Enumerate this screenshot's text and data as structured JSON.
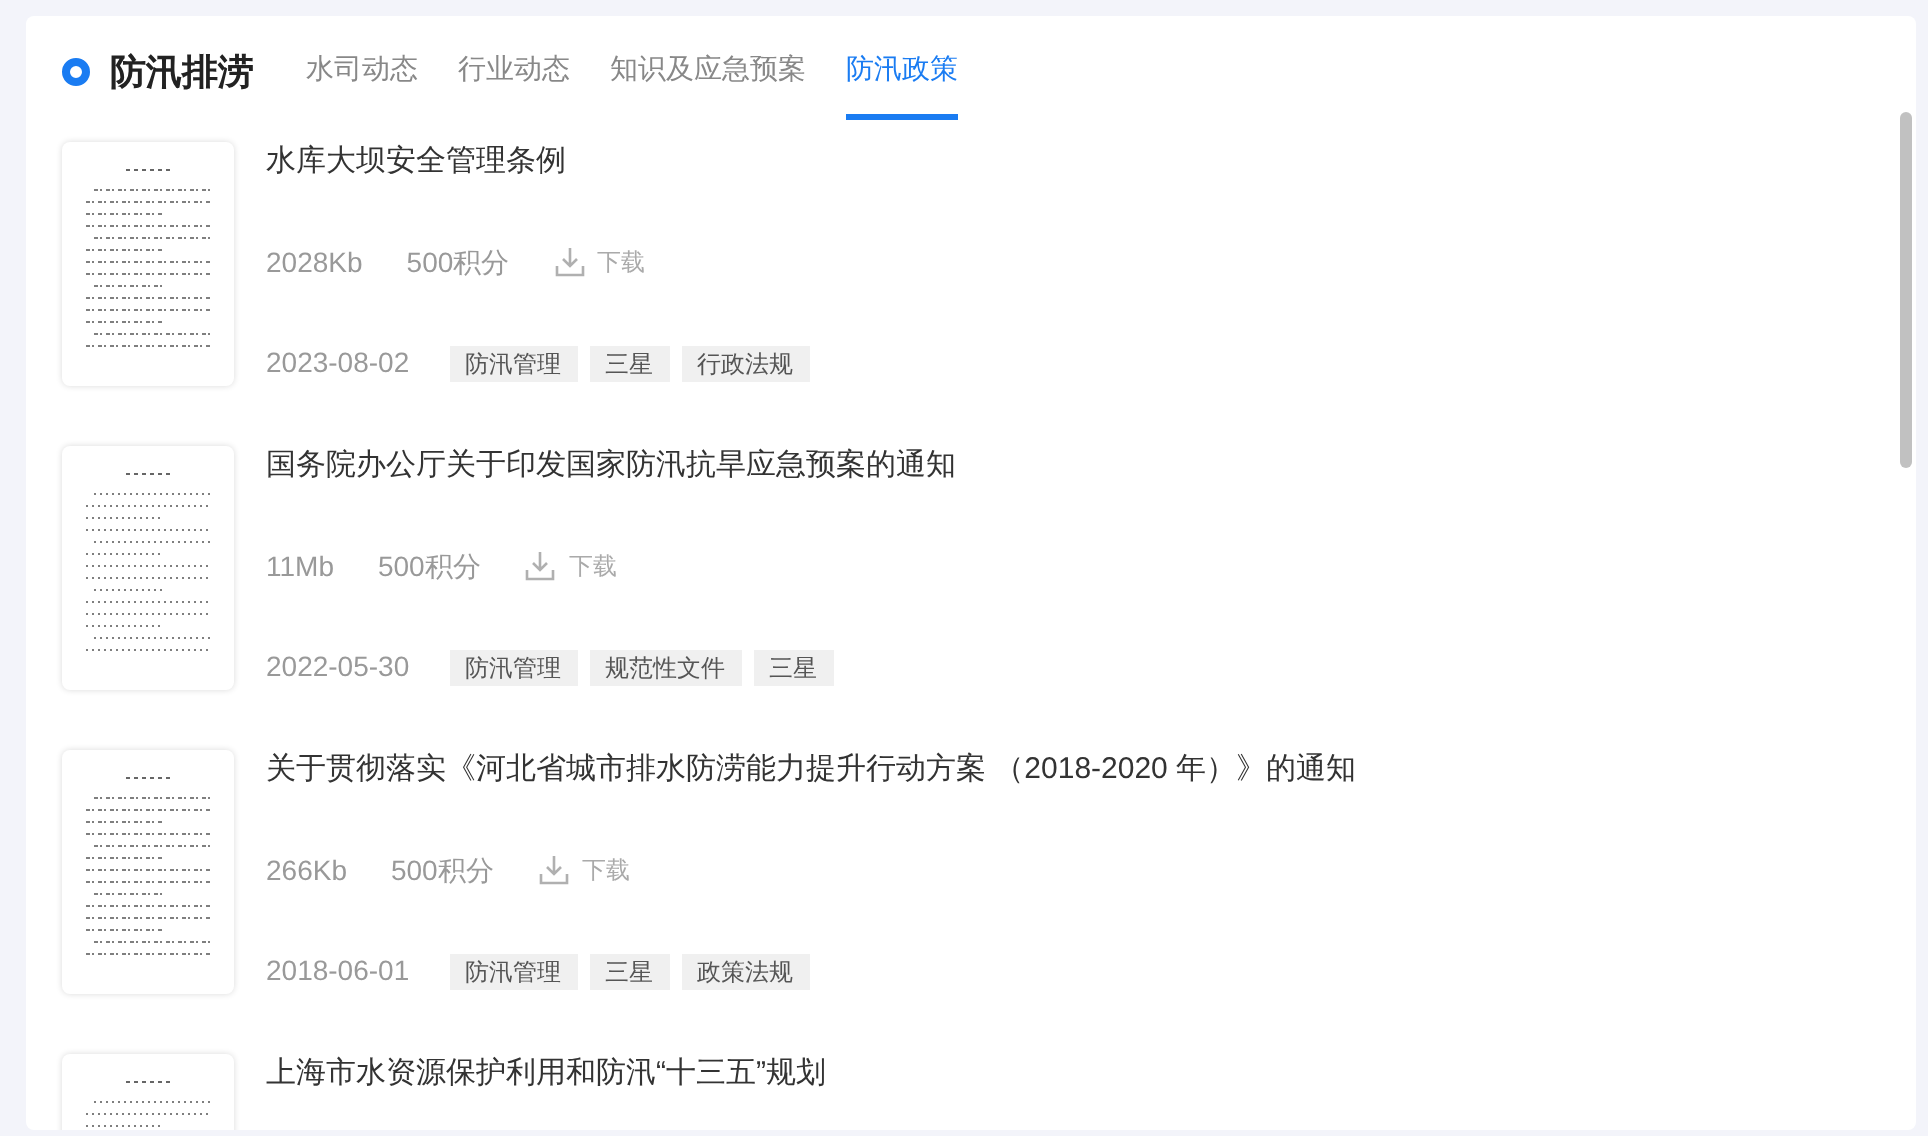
{
  "header": {
    "title": "防汛排涝"
  },
  "tabs": [
    {
      "label": "水司动态",
      "selected": false
    },
    {
      "label": "行业动态",
      "selected": false
    },
    {
      "label": "知识及应急预案",
      "selected": false
    },
    {
      "label": "防汛政策",
      "selected": true
    }
  ],
  "documents": [
    {
      "title": "水库大坝安全管理条例",
      "size": "2028Kb",
      "points": "500积分",
      "download": "下载",
      "date": "2023-08-02",
      "tags": [
        "防汛管理",
        "三星",
        "行政法规"
      ]
    },
    {
      "title": "国务院办公厅关于印发国家防汛抗旱应急预案的通知",
      "size": "11Mb",
      "points": "500积分",
      "download": "下载",
      "date": "2022-05-30",
      "tags": [
        "防汛管理",
        "规范性文件",
        "三星"
      ]
    },
    {
      "title": "关于贯彻落实《河北省城市排水防涝能力提升行动方案 （2018-2020 年）》的通知",
      "size": "266Kb",
      "points": "500积分",
      "download": "下载",
      "date": "2018-06-01",
      "tags": [
        "防汛管理",
        "三星",
        "政策法规"
      ]
    },
    {
      "title": "上海市水资源保护利用和防汛“十三五”规划"
    }
  ]
}
